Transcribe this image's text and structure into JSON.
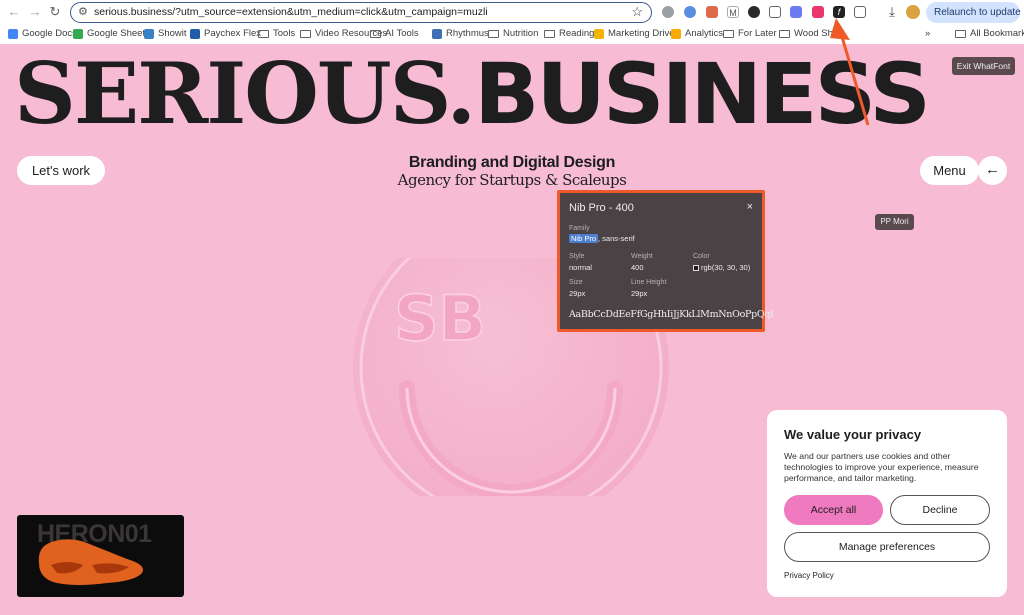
{
  "browser": {
    "url": "serious.business/?utm_source=extension&utm_medium=click&utm_campaign=muzli",
    "relaunch_label": "Relaunch to update",
    "bookmarks": [
      {
        "label": "Google Docs",
        "icon": "google-docs-icon",
        "color": "#4285f4"
      },
      {
        "label": "Google Sheets",
        "icon": "google-sheets-icon",
        "color": "#34a853"
      },
      {
        "label": "Showit",
        "icon": "showit-icon",
        "color": "#3b82c4"
      },
      {
        "label": "Paychex Flex",
        "icon": "paychex-icon",
        "color": "#1f5ea8"
      },
      {
        "label": "Tools",
        "icon": "folder-icon"
      },
      {
        "label": "Video Resources",
        "icon": "folder-icon"
      },
      {
        "label": "AI Tools",
        "icon": "folder-icon"
      },
      {
        "label": "Rhythmus",
        "icon": "rhythmus-icon",
        "color": "#3f6fb5"
      },
      {
        "label": "Nutrition",
        "icon": "folder-icon"
      },
      {
        "label": "Reading",
        "icon": "folder-icon"
      },
      {
        "label": "Marketing Drive",
        "icon": "google-drive-icon",
        "color": "#f4b400"
      },
      {
        "label": "Analytics",
        "icon": "analytics-icon",
        "color": "#f9ab00"
      },
      {
        "label": "For Later",
        "icon": "folder-icon"
      },
      {
        "label": "Wood Shed",
        "icon": "folder-icon"
      }
    ],
    "more_label": "»",
    "all_bookmarks_label": "All Bookmarks"
  },
  "page": {
    "title_serif": "SERIOUS.",
    "title_sans": "BUSINESS",
    "lets_work_label": "Let's work",
    "tagline_1": "Branding and Digital Design",
    "tagline_2": "Agency for Startups & Scaleups",
    "menu_label": "Menu",
    "back_arrow": "←",
    "emblem_text": "SB",
    "thumbnail_text": "HERON01"
  },
  "whatfont": {
    "exit_label": "Exit WhatFont",
    "hover_tag": "PP Mori",
    "panel_title": "Nib Pro - 400",
    "close": "×",
    "family_label": "Family",
    "family_highlight": "Nib Pro",
    "family_rest": ", sans-serif",
    "style_label": "Style",
    "style_value": "normal",
    "weight_label": "Weight",
    "weight_value": "400",
    "color_label": "Color",
    "color_value": "rgb(30, 30, 30)",
    "size_label": "Size",
    "size_value": "29px",
    "line_height_label": "Line Height",
    "line_height_value": "29px",
    "sample": "AaBbCcDdEeFfGgHhIiJjKkLlMmNnOoPpQqI"
  },
  "cookie": {
    "title": "We value your privacy",
    "body": "We and our partners use cookies and other technologies to improve your experience, measure performance, and tailor marketing.",
    "accept_label": "Accept all",
    "decline_label": "Decline",
    "manage_label": "Manage preferences",
    "privacy_label": "Privacy Policy"
  },
  "colors": {
    "page_bg": "#f7bcd3",
    "accent_pink": "#f07ac0",
    "annotation_orange": "#f05a28",
    "text_dark": "#1e1e1e"
  }
}
